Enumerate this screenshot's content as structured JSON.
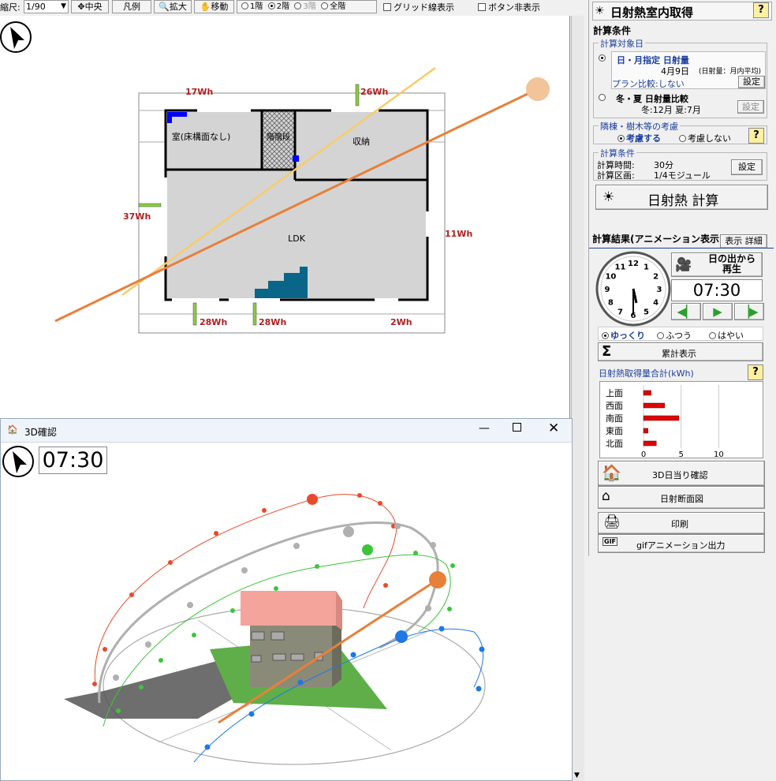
{
  "toolbar": {
    "scale_label": "縮尺:",
    "scale_value": "1/90",
    "center_btn": "中央",
    "legend_btn": "凡例",
    "zoom_btn": "拡大",
    "move_btn": "移動",
    "floor_options": [
      "1階",
      "2階",
      "3階",
      "全階"
    ],
    "floor_selected": "2階",
    "grid_label": "グリッド線表示",
    "hide_btn_label": "ボタン非表示"
  },
  "plan": {
    "rooms": {
      "room_nofloor": "室(床構面なし)",
      "stair": "階階段",
      "storage": "収納",
      "ldk": "LDK"
    },
    "window_labels": [
      "17Wh",
      "26Wh",
      "37Wh",
      "11Wh",
      "28Wh",
      "28Wh",
      "2Wh"
    ]
  },
  "win3d": {
    "title": "3D確認",
    "time": "07:30"
  },
  "panel": {
    "title": "日射熱室内取得",
    "help": "?",
    "calc_conditions": "計算条件",
    "target_day_legend": "計算対象日",
    "opt1_title": "日・月指定 日射量",
    "opt1_date": "4月9日",
    "opt1_note": "(日射量：月内平均)",
    "plan_compare": "プラン比較:しない",
    "set": "設定",
    "opt2_title": "冬・夏 日射量比較",
    "opt2_detail": "冬:12月 夏:7月",
    "shading_legend": "隣棟・樹木等の考慮",
    "shading_on": "考慮する",
    "shading_off": "考慮しない",
    "calc_cond_legend": "計算条件",
    "calc_time_label": "計算時間:",
    "calc_time_value": "30分",
    "calc_area_label": "計算区画:",
    "calc_area_value": "1/4モジュール",
    "calc_button": "日射熱 計算",
    "result_title": "計算結果(アニメーション表示)",
    "result_detail_btn": "表示 詳細",
    "replay_btn_line1": "日の出から",
    "replay_btn_line2": "再生",
    "time": "07:30",
    "speed_options": [
      "ゆっくり",
      "ふつう",
      "はやい"
    ],
    "speed_selected": "ゆっくり",
    "cumulative_btn": "累計表示",
    "sigma": "Σ",
    "chart_legend": "日射熱取得量合計(kWh)",
    "btn_3d": "3D日当り確認",
    "btn_section": "日射断面図",
    "btn_print": "印刷",
    "btn_gif": "gifアニメーション出力",
    "clock_numbers": [
      "12",
      "1",
      "2",
      "3",
      "4",
      "5",
      "6",
      "7",
      "8",
      "9",
      "10",
      "11"
    ],
    "clock_time": "7:30"
  },
  "chart_data": {
    "type": "bar",
    "orientation": "horizontal",
    "title": "日射熱取得量合計(kWh)",
    "categories": [
      "上面",
      "西面",
      "南面",
      "東面",
      "北面"
    ],
    "values": [
      1.0,
      2.8,
      4.7,
      0.6,
      1.7
    ],
    "xlim": [
      0,
      15
    ],
    "xticks": [
      0,
      5,
      10
    ],
    "color": "#e00000",
    "grid": true
  },
  "colors": {
    "sun_line": "#e8803a",
    "sun_disk": "#f3c39a",
    "summer_path": "#e84a2a",
    "equinox_path": "#b0b0b0",
    "green_path": "#3cc43c",
    "winter_path": "#1e78e6",
    "roof": "#f4a49a",
    "wall": "#8a8a78",
    "lawn": "#5fae4a",
    "accent_blue": "#1b3fa0"
  }
}
